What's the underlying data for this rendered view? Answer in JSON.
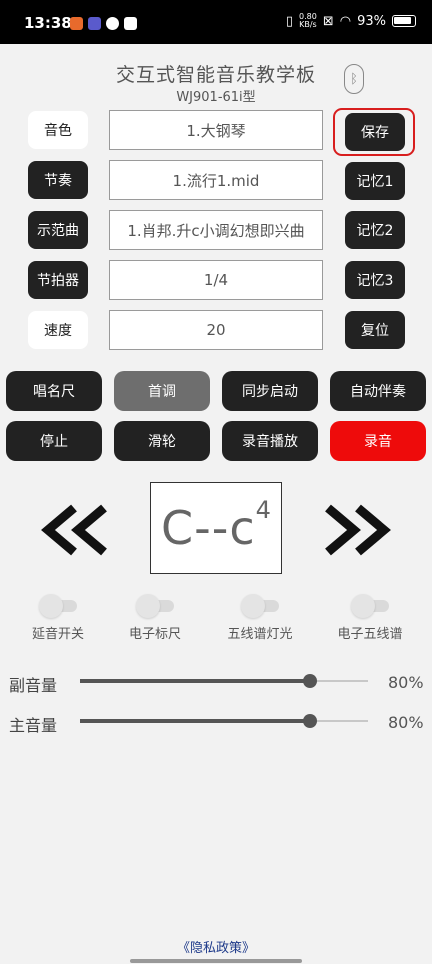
{
  "status": {
    "time": "13:38",
    "net_speed_value": "0.80",
    "net_speed_unit": "KB/s",
    "battery": "93%"
  },
  "header": {
    "title": "交互式智能音乐教学板",
    "model": "WJ901-61i型"
  },
  "rows": [
    {
      "label": "音色",
      "value": "1.大钢琴",
      "button": "保存"
    },
    {
      "label": "节奏",
      "value": "1.流行1.mid",
      "button": "记忆1"
    },
    {
      "label": "示范曲",
      "value": "1.肖邦.升c小调幻想即兴曲",
      "button": "记忆2"
    },
    {
      "label": "节拍器",
      "value": "1/4",
      "button": "记忆3"
    },
    {
      "label": "速度",
      "value": "20",
      "button": "复位"
    }
  ],
  "controls": {
    "row1": [
      "唱名尺",
      "首调",
      "同步启动",
      "自动伴奏"
    ],
    "row2": [
      "停止",
      "滑轮",
      "录音播放",
      "录音"
    ]
  },
  "note_display": {
    "text": "C--c",
    "superscript": "4"
  },
  "toggles": [
    {
      "label": "延音开关",
      "on": false
    },
    {
      "label": "电子标尺",
      "on": false
    },
    {
      "label": "五线谱灯光",
      "on": false
    },
    {
      "label": "电子五线谱",
      "on": false
    }
  ],
  "sliders": [
    {
      "label": "副音量",
      "value": 80,
      "display": "80%"
    },
    {
      "label": "主音量",
      "value": 80,
      "display": "80%"
    }
  ],
  "footer": {
    "privacy": "《隐私政策》"
  },
  "colors": {
    "dark_button": "#222222",
    "record_button": "#ee0b0b",
    "save_highlight": "#d81e1e",
    "privacy_link": "#1e3a8a"
  }
}
